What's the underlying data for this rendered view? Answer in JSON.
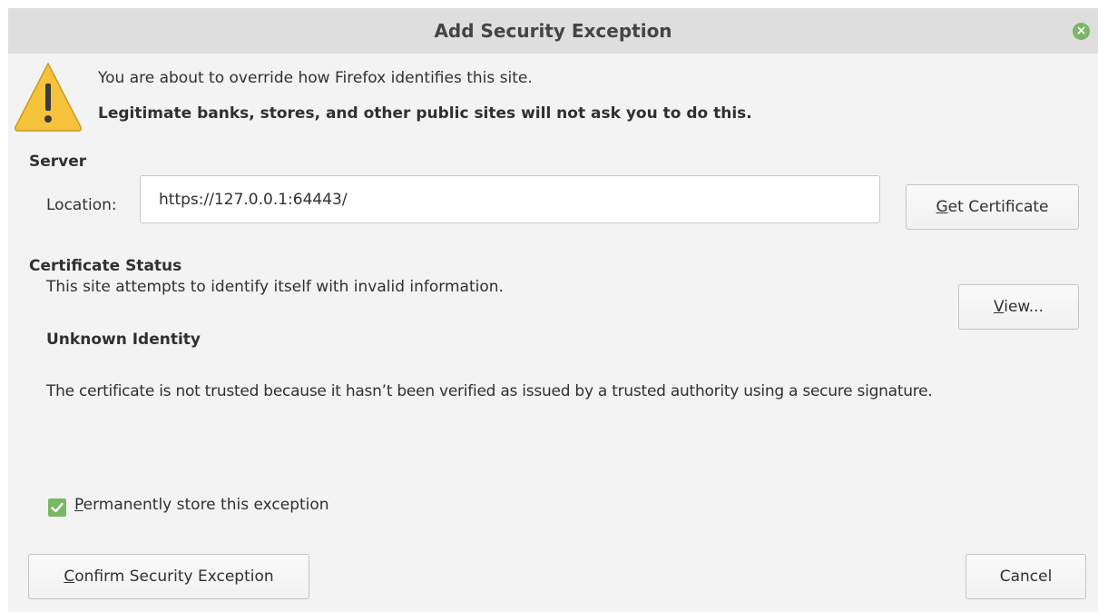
{
  "window": {
    "title": "Add Security Exception",
    "close_icon": "close-icon"
  },
  "warning": {
    "icon": "warning-icon",
    "line1": "You are about to override how Firefox identifies this site.",
    "line2": "Legitimate banks, stores, and other public sites will not ask you to do this."
  },
  "server": {
    "heading": "Server",
    "location_label": "Location:",
    "location_value": "https://127.0.0.1:64443/",
    "get_certificate": {
      "mnemonic": "G",
      "rest": "et Certificate"
    }
  },
  "certificate_status": {
    "heading": "Certificate Status",
    "status_text": "This site attempts to identify itself with invalid information.",
    "view_button": {
      "mnemonic": "V",
      "rest": "iew..."
    },
    "identity_heading": "Unknown Identity",
    "description": "The certificate is not trusted because it hasn’t been verified as issued by a trusted authority using a secure signature."
  },
  "permanent": {
    "checked": true,
    "mnemonic": "P",
    "rest": "ermanently store this exception"
  },
  "footer": {
    "confirm_button": {
      "mnemonic": "C",
      "rest": "onfirm Security Exception"
    },
    "cancel_button": "Cancel"
  },
  "colors": {
    "titlebar": "#dedede",
    "dialog_bg": "#f3f3f3",
    "accent_green": "#79b864",
    "warning_yellow": "#f5c33b"
  }
}
